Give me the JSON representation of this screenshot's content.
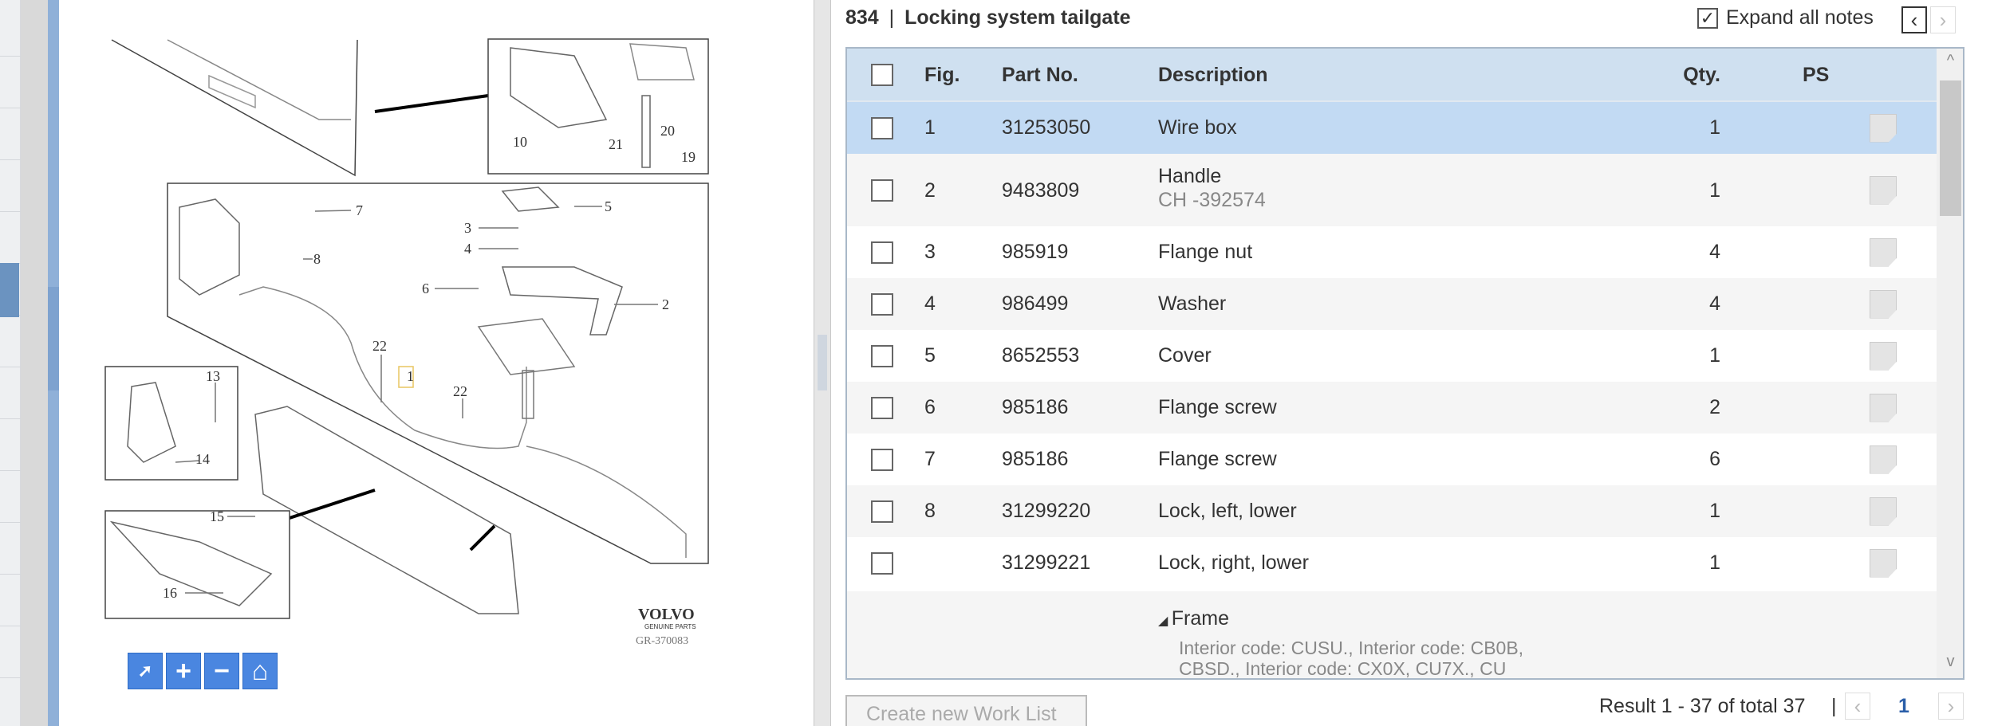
{
  "diagram": {
    "callouts": [
      "1",
      "2",
      "3",
      "4",
      "5",
      "6",
      "7",
      "8",
      "10",
      "13",
      "14",
      "15",
      "16",
      "19",
      "20",
      "21",
      "22",
      "22"
    ],
    "brand": "VOLVO",
    "brand_sub": "GENUINE PARTS",
    "drawing_id": "GR-370083",
    "toolbar": [
      {
        "icon": "pointer-icon"
      },
      {
        "icon": "zoom-in-icon",
        "glyph": "+"
      },
      {
        "icon": "zoom-out-icon",
        "glyph": "−"
      },
      {
        "icon": "home-icon",
        "glyph": "⌂"
      }
    ]
  },
  "header": {
    "group": "834",
    "separator": "|",
    "title": "Locking system tailgate",
    "expand_all_notes": "Expand all notes",
    "expand_checked": true
  },
  "table": {
    "columns": [
      "Fig.",
      "Part No.",
      "Description",
      "Qty.",
      "PS"
    ],
    "rows": [
      {
        "fig": "1",
        "part": "31253050",
        "desc": "Wire box",
        "sub": "",
        "qty": "1",
        "selected": true
      },
      {
        "fig": "2",
        "part": "9483809",
        "desc": "Handle",
        "sub": "CH -392574",
        "qty": "1"
      },
      {
        "fig": "3",
        "part": "985919",
        "desc": "Flange nut",
        "sub": "",
        "qty": "4"
      },
      {
        "fig": "4",
        "part": "986499",
        "desc": "Washer",
        "sub": "",
        "qty": "4"
      },
      {
        "fig": "5",
        "part": "8652553",
        "desc": "Cover",
        "sub": "",
        "qty": "1"
      },
      {
        "fig": "6",
        "part": "985186",
        "desc": "Flange screw",
        "sub": "",
        "qty": "2"
      },
      {
        "fig": "7",
        "part": "985186",
        "desc": "Flange screw",
        "sub": "",
        "qty": "6"
      },
      {
        "fig": "8",
        "part": "31299220",
        "desc": "Lock, left, lower",
        "sub": "",
        "qty": "1"
      },
      {
        "fig": "",
        "part": "31299221",
        "desc": "Lock, right, lower",
        "sub": "",
        "qty": "1"
      }
    ],
    "note": {
      "heading": "Frame",
      "line1": "Interior code: CUSU., Interior code: CB0B,",
      "line2": "CBSD., Interior code: CX0X, CU7X., CU"
    }
  },
  "footer": {
    "create_button": "Create new Work List",
    "result": "Result 1 - 37 of total 37",
    "page": "1"
  }
}
